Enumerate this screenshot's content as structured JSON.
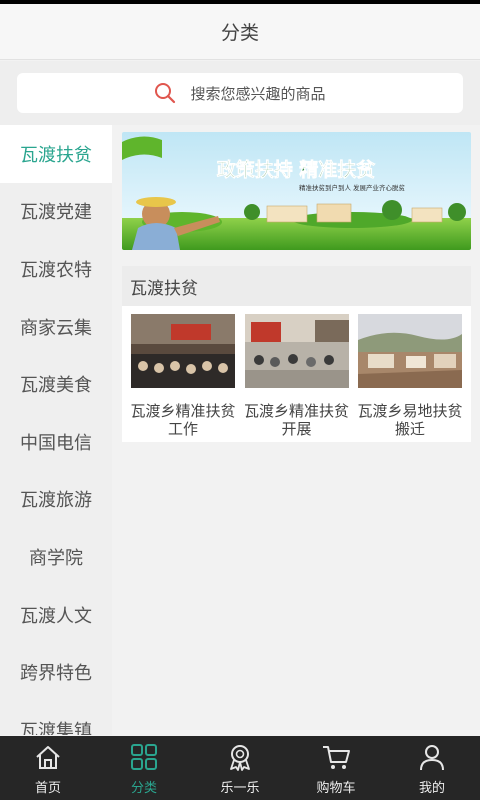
{
  "header": {
    "title": "分类"
  },
  "search": {
    "placeholder": "搜索您感兴趣的商品"
  },
  "sidebar": {
    "items": [
      {
        "label": "瓦渡扶贫",
        "active": true
      },
      {
        "label": "瓦渡党建"
      },
      {
        "label": "瓦渡农特"
      },
      {
        "label": "商家云集"
      },
      {
        "label": "瓦渡美食"
      },
      {
        "label": "中国电信"
      },
      {
        "label": "瓦渡旅游"
      },
      {
        "label": "商学院"
      },
      {
        "label": "瓦渡人文"
      },
      {
        "label": "跨界特色"
      },
      {
        "label": "瓦渡集镇"
      }
    ]
  },
  "banner": {
    "headline": "政策扶持 精准扶贫",
    "subline": "精准扶贫到户到人  发展产业齐心脱贫"
  },
  "section": {
    "title": "瓦渡扶贫",
    "products": [
      {
        "name": "瓦渡乡精准扶贫工作"
      },
      {
        "name": "瓦渡乡精准扶贫开展"
      },
      {
        "name": "瓦渡乡易地扶贫搬迁"
      }
    ]
  },
  "tabbar": {
    "tabs": [
      {
        "label": "首页",
        "icon": "home-icon"
      },
      {
        "label": "分类",
        "icon": "category-grid-icon",
        "active": true
      },
      {
        "label": "乐一乐",
        "icon": "award-badge-icon"
      },
      {
        "label": "购物车",
        "icon": "cart-icon"
      },
      {
        "label": "我的",
        "icon": "user-icon"
      }
    ]
  },
  "colors": {
    "accent": "#2aa58f",
    "tabbar_bg": "#262626",
    "banner_headline": "#1a7a2a"
  }
}
